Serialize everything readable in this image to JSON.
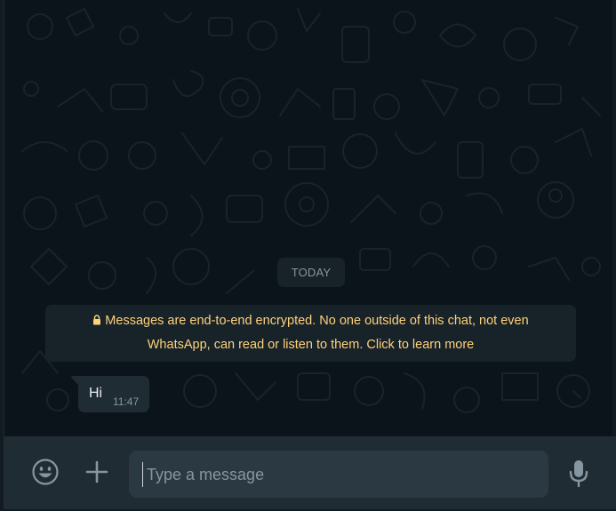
{
  "chat": {
    "date_separator": "TODAY",
    "encryption_notice_line1": "Messages are end-to-end encrypted. No one outside of this chat, not even",
    "encryption_notice_line2": "WhatsApp, can read or listen to them. Click to learn more",
    "messages": [
      {
        "text": "Hi",
        "time": "11:47",
        "direction": "incoming"
      }
    ]
  },
  "composer": {
    "placeholder": "Type a message",
    "value": "",
    "emoji_icon": "emoji-icon",
    "attach_icon": "plus-icon",
    "mic_icon": "microphone-icon"
  },
  "colors": {
    "background": "#0b141a",
    "bubble": "#202c33",
    "system_text": "#ffd279",
    "footer": "#202c33",
    "input": "#2a3942"
  }
}
